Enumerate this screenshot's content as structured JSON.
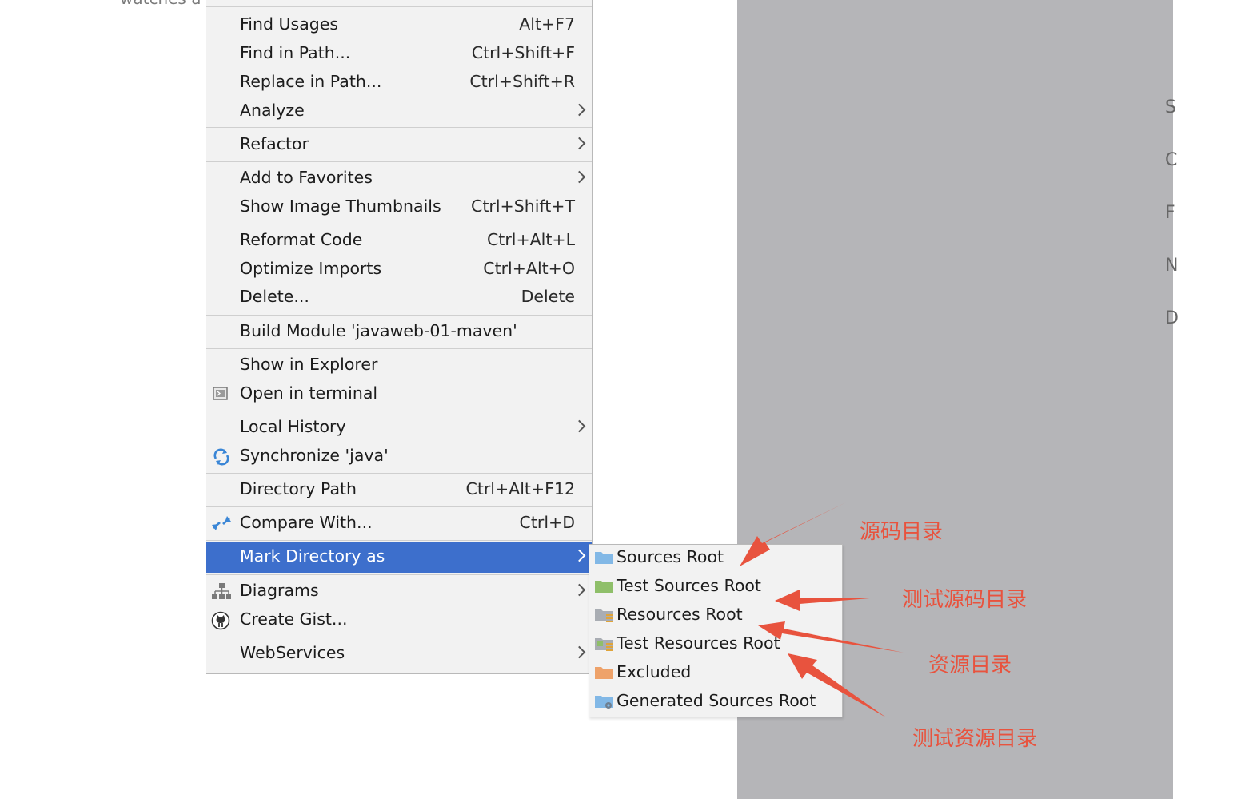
{
  "background": {
    "top_text": "watches a",
    "right_letters": [
      "S",
      "C",
      "F",
      "N",
      "D"
    ]
  },
  "menu": {
    "items": [
      {
        "label": "Find Usages",
        "shortcut": "Alt+F7"
      },
      {
        "label": "Find in Path...",
        "shortcut": "Ctrl+Shift+F"
      },
      {
        "label": "Replace in Path...",
        "shortcut": "Ctrl+Shift+R"
      },
      {
        "label": "Analyze",
        "shortcut": ""
      },
      {
        "label": "Refactor",
        "shortcut": ""
      },
      {
        "label": "Add to Favorites",
        "shortcut": ""
      },
      {
        "label": "Show Image Thumbnails",
        "shortcut": "Ctrl+Shift+T"
      },
      {
        "label": "Reformat Code",
        "shortcut": "Ctrl+Alt+L"
      },
      {
        "label": "Optimize Imports",
        "shortcut": "Ctrl+Alt+O"
      },
      {
        "label": "Delete...",
        "shortcut": "Delete"
      },
      {
        "label": "Build Module 'javaweb-01-maven'",
        "shortcut": ""
      },
      {
        "label": "Show in Explorer",
        "shortcut": ""
      },
      {
        "label": "Open in terminal",
        "shortcut": ""
      },
      {
        "label": "Local History",
        "shortcut": ""
      },
      {
        "label": "Synchronize 'java'",
        "shortcut": ""
      },
      {
        "label": "Directory Path",
        "shortcut": "Ctrl+Alt+F12"
      },
      {
        "label": "Compare With...",
        "shortcut": "Ctrl+D"
      },
      {
        "label": "Mark Directory as",
        "shortcut": ""
      },
      {
        "label": "Diagrams",
        "shortcut": ""
      },
      {
        "label": "Create Gist...",
        "shortcut": ""
      },
      {
        "label": "WebServices",
        "shortcut": ""
      }
    ],
    "highlight_color": "#3d6fcc"
  },
  "submenu": {
    "items": [
      {
        "label": "Sources Root",
        "icon": "sources-root-folder-icon"
      },
      {
        "label": "Test Sources Root",
        "icon": "test-sources-root-folder-icon"
      },
      {
        "label": "Resources Root",
        "icon": "resources-root-folder-icon"
      },
      {
        "label": "Test Resources Root",
        "icon": "test-resources-root-folder-icon"
      },
      {
        "label": "Excluded",
        "icon": "excluded-folder-icon"
      },
      {
        "label": "Generated Sources Root",
        "icon": "generated-sources-root-folder-icon"
      }
    ]
  },
  "annotations": {
    "sources": "源码目录",
    "test_sources": "测试源码目录",
    "resources": "资源目录",
    "test_resources": "测试资源目录",
    "color": "#e8533e"
  }
}
